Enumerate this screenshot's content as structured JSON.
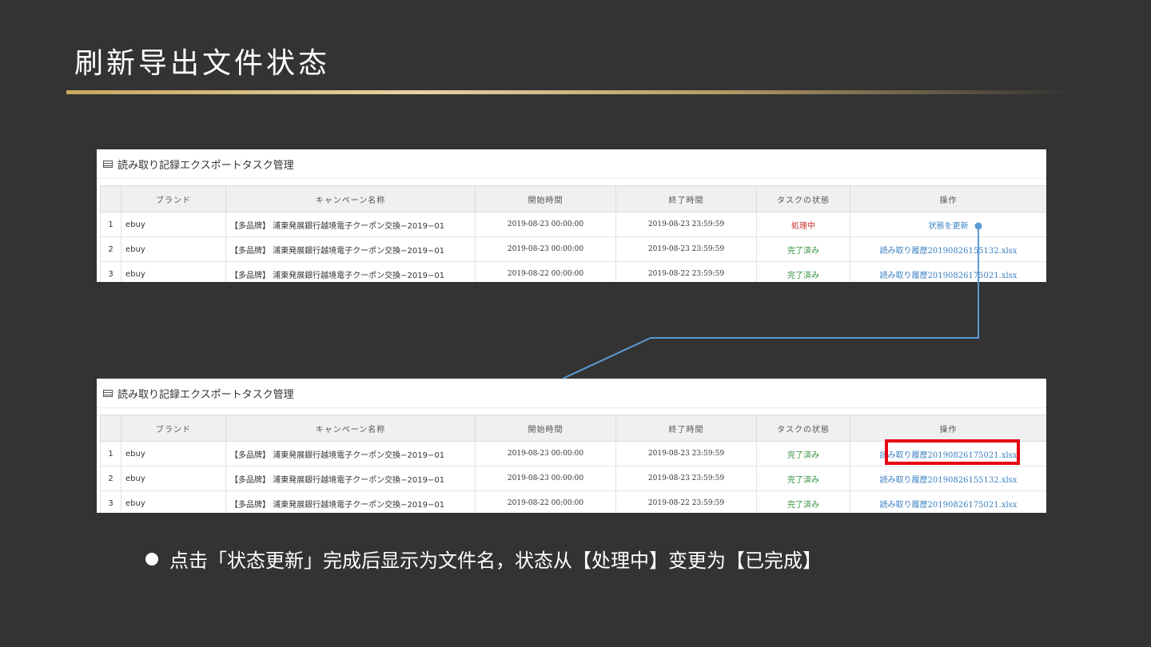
{
  "slide": {
    "title": "刷新导出文件状态",
    "bullet": "点击「状态更新」完成后显示为文件名，状态从【处理中】变更为【已完成】"
  },
  "colors": {
    "background": "#333333",
    "gold_accent": "#c9a760",
    "status_processing": "#c9302c",
    "status_done": "#2f8f3a",
    "link": "#3a7fc1",
    "highlight": "#e60012",
    "connector": "#5b9bd5"
  },
  "panel_a": {
    "title": "読み取り記録エクスポートタスク管理",
    "icon": "list-icon",
    "columns": [
      "",
      "ブランド",
      "キャンペーン名称",
      "開始時間",
      "終了時間",
      "タスクの状態",
      "操作"
    ],
    "rows": [
      {
        "no": "1",
        "brand": "ebuy",
        "campaign": "【多品牌】 浦東発展銀行越境電子クーポン交換−2019−01",
        "start": "2019-08-23 00:00:00",
        "end": "2019-08-23 23:59:59",
        "status": "処理中",
        "action": "状態を更新"
      },
      {
        "no": "2",
        "brand": "ebuy",
        "campaign": "【多品牌】 浦東発展銀行越境電子クーポン交換−2019−01",
        "start": "2019-08-23 00:00:00",
        "end": "2019-08-23 23:59:59",
        "status": "完了済み",
        "action": "読み取り履歴20190826155132.xlsx"
      },
      {
        "no": "3",
        "brand": "ebuy",
        "campaign": "【多品牌】 浦東発展銀行越境電子クーポン交換−2019−01",
        "start": "2019-08-22 00:00:00",
        "end": "2019-08-22 23:59:59",
        "status": "完了済み",
        "action": "読み取り履歴20190826175021.xlsx"
      }
    ]
  },
  "panel_b": {
    "title": "読み取り記録エクスポートタスク管理",
    "icon": "list-icon",
    "columns": [
      "",
      "ブランド",
      "キャンペーン名称",
      "開始時間",
      "終了時間",
      "タスクの状態",
      "操作"
    ],
    "rows": [
      {
        "no": "1",
        "brand": "ebuy",
        "campaign": "【多品牌】 浦東発展銀行越境電子クーポン交換−2019−01",
        "start": "2019-08-23 00:00:00",
        "end": "2019-08-23 23:59:59",
        "status": "完了済み",
        "action": "読み取り履歴20190826175021.xlsx"
      },
      {
        "no": "2",
        "brand": "ebuy",
        "campaign": "【多品牌】 浦東発展銀行越境電子クーポン交換−2019−01",
        "start": "2019-08-23 00:00:00",
        "end": "2019-08-23 23:59:59",
        "status": "完了済み",
        "action": "読み取り履歴20190826155132.xlsx"
      },
      {
        "no": "3",
        "brand": "ebuy",
        "campaign": "【多品牌】 浦東発展銀行越境電子クーポン交換−2019−01",
        "start": "2019-08-22 00:00:00",
        "end": "2019-08-22 23:59:59",
        "status": "完了済み",
        "action": "読み取り履歴20190826175021.xlsx"
      }
    ]
  }
}
